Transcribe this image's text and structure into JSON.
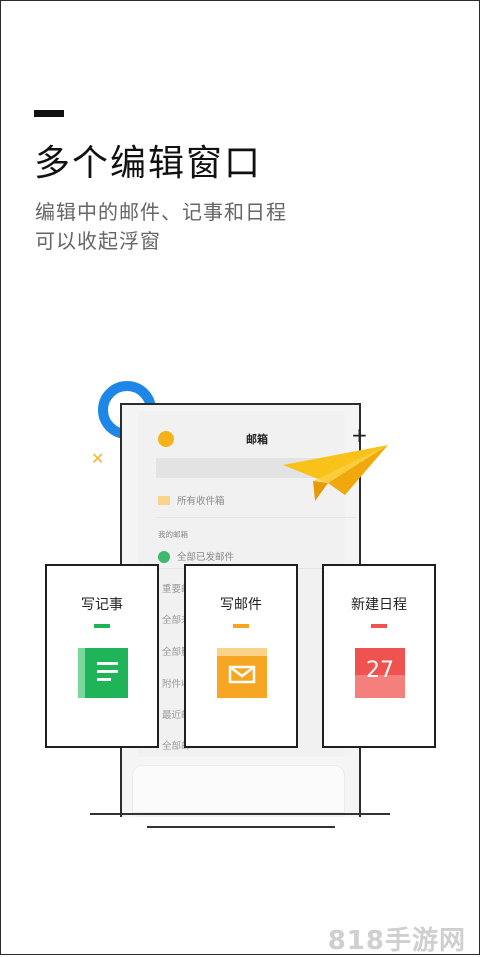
{
  "header": {
    "title": "多个编辑窗口",
    "subtitle_line1": "编辑中的邮件、记事和日程",
    "subtitle_line2": "可以收起浮窗"
  },
  "phone": {
    "title": "邮箱",
    "plus": "+",
    "inbox_label": "所有收件箱",
    "section_label": "我的邮箱",
    "sent_label": "全部已发邮件",
    "truncated_rows": [
      "重要邮",
      "全部未",
      "全部删",
      "附件收",
      "最近邮",
      "全部邮"
    ]
  },
  "cards": [
    {
      "label": "写记事",
      "color": "#1fb457"
    },
    {
      "label": "写邮件",
      "color": "#f6a623"
    },
    {
      "label": "新建日程",
      "color": "#ef5350",
      "date": "27"
    }
  ],
  "watermark": "818手游网",
  "colors": {
    "blue": "#1e86e6",
    "yellow": "#f6b21b",
    "green": "#1fb457",
    "orange": "#f6a623",
    "red": "#ef5350"
  }
}
